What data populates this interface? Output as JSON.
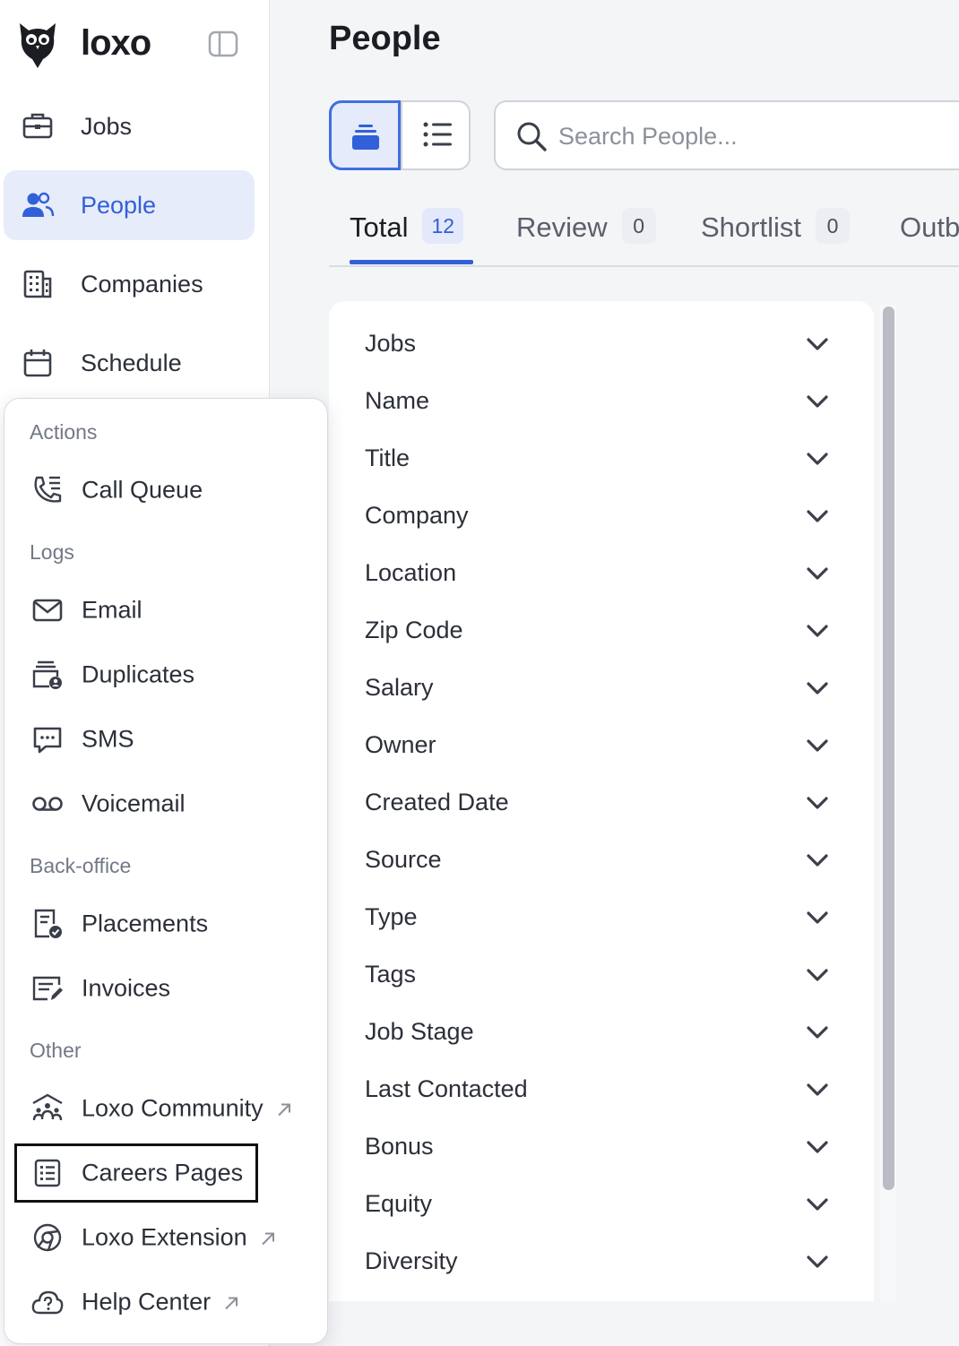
{
  "brand": {
    "name": "loxo"
  },
  "sidebar": {
    "items": [
      {
        "label": "Jobs",
        "icon": "briefcase-icon",
        "active": false
      },
      {
        "label": "People",
        "icon": "people-icon",
        "active": true
      },
      {
        "label": "Companies",
        "icon": "building-icon",
        "active": false
      },
      {
        "label": "Schedule",
        "icon": "calendar-icon",
        "active": false
      }
    ]
  },
  "menu": {
    "sections": [
      {
        "title": "Actions",
        "items": [
          {
            "label": "Call Queue",
            "icon": "phone-list-icon",
            "external": false
          }
        ]
      },
      {
        "title": "Logs",
        "items": [
          {
            "label": "Email",
            "icon": "envelope-icon",
            "external": false
          },
          {
            "label": "Duplicates",
            "icon": "duplicates-icon",
            "external": false
          },
          {
            "label": "SMS",
            "icon": "chat-bubble-icon",
            "external": false
          },
          {
            "label": "Voicemail",
            "icon": "voicemail-icon",
            "external": false
          }
        ]
      },
      {
        "title": "Back-office",
        "items": [
          {
            "label": "Placements",
            "icon": "document-check-icon",
            "external": false
          },
          {
            "label": "Invoices",
            "icon": "invoice-edit-icon",
            "external": false
          }
        ]
      },
      {
        "title": "Other",
        "items": [
          {
            "label": "Loxo Community",
            "icon": "community-icon",
            "external": true
          },
          {
            "label": "Careers Pages",
            "icon": "list-page-icon",
            "external": false,
            "highlighted": true
          },
          {
            "label": "Loxo Extension",
            "icon": "chrome-icon",
            "external": true
          },
          {
            "label": "Help Center",
            "icon": "help-cloud-icon",
            "external": true
          }
        ]
      }
    ]
  },
  "main": {
    "title": "People",
    "search": {
      "placeholder": "Search People...",
      "value": ""
    },
    "tabs": [
      {
        "label": "Total",
        "count": "12",
        "active": true
      },
      {
        "label": "Review",
        "count": "0",
        "active": false
      },
      {
        "label": "Shortlist",
        "count": "0",
        "active": false
      },
      {
        "label": "Outb",
        "count": "",
        "active": false
      }
    ],
    "filters": [
      "Jobs",
      "Name",
      "Title",
      "Company",
      "Location",
      "Zip Code",
      "Salary",
      "Owner",
      "Created Date",
      "Source",
      "Type",
      "Tags",
      "Job Stage",
      "Last Contacted",
      "Bonus",
      "Equity",
      "Diversity"
    ]
  },
  "colors": {
    "accent": "#3160d8",
    "active_bg": "#e7ecfb",
    "highlight_border": "#111111"
  }
}
